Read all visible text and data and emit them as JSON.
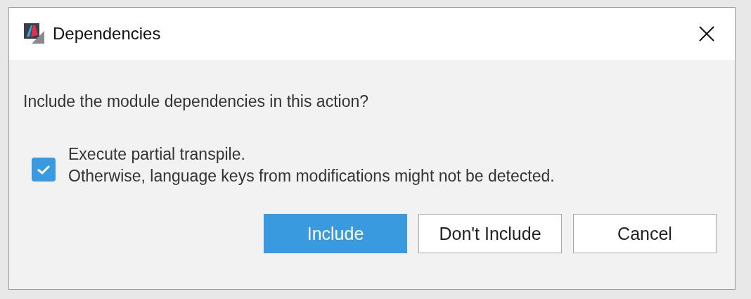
{
  "window": {
    "title": "Dependencies"
  },
  "message": "Include the module dependencies in this action?",
  "option": {
    "checked": true,
    "label": "Execute partial transpile.",
    "note": "Otherwise, language keys from modifications might not be detected."
  },
  "buttons": [
    {
      "label": "Include",
      "kind": "primary"
    },
    {
      "label": "Don't Include",
      "kind": "default"
    },
    {
      "label": "Cancel",
      "kind": "default"
    }
  ]
}
